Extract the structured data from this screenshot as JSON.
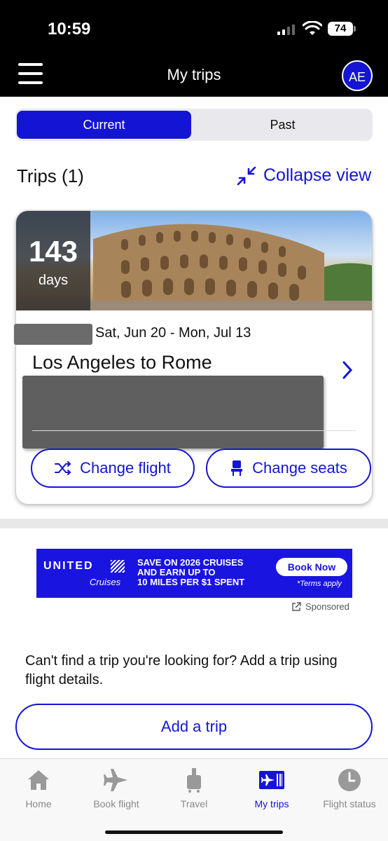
{
  "status_bar": {
    "time": "10:59",
    "battery": "74"
  },
  "header": {
    "title": "My trips",
    "avatar_initials": "AE"
  },
  "tabs": [
    {
      "label": "Current",
      "selected": true
    },
    {
      "label": "Past",
      "selected": false
    }
  ],
  "trips_section": {
    "title": "Trips (1)",
    "collapse_label": "Collapse view"
  },
  "trip_card": {
    "days_count": "143",
    "days_label": "days",
    "dates": "Sat, Jun 20 - Mon, Jul 13",
    "route": "Los Angeles to Rome",
    "change_flight_label": "Change flight",
    "change_seats_label": "Change seats"
  },
  "ad": {
    "brand": "UNITED",
    "sub_brand": "Cruises",
    "headline_line1": "SAVE ON 2026 CRUISES",
    "headline_line2": "AND EARN UP TO",
    "headline_line3": "10 MILES PER $1 SPENT",
    "cta": "Book Now",
    "terms": "*Terms apply",
    "sponsored_label": "Sponsored"
  },
  "add_trip": {
    "prompt": "Can't find a trip you're looking for? Add a trip using flight details.",
    "button_label": "Add a trip"
  },
  "bottom_nav": [
    {
      "label": "Home",
      "icon": "home-icon",
      "active": false
    },
    {
      "label": "Book flight",
      "icon": "airplane-icon",
      "active": false
    },
    {
      "label": "Travel",
      "icon": "luggage-icon",
      "active": false
    },
    {
      "label": "My trips",
      "icon": "boarding-pass-icon",
      "active": true
    },
    {
      "label": "Flight status",
      "icon": "clock-icon",
      "active": false
    }
  ],
  "colors": {
    "accent": "#1414d4",
    "header_bg": "#000000",
    "ad_bg": "#1a14e0"
  }
}
